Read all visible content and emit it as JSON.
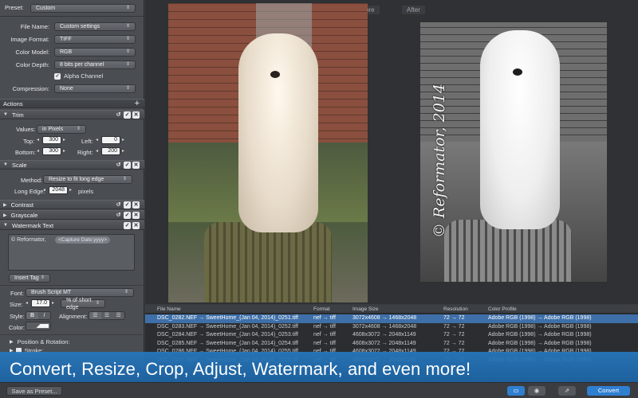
{
  "sidebar": {
    "preset": {
      "label": "Preset:",
      "value": "Custom"
    },
    "file_name": {
      "label": "File Name:",
      "value": "Custom settings"
    },
    "image_format": {
      "label": "Image Format:",
      "value": "TIFF"
    },
    "color_model": {
      "label": "Color Model:",
      "value": "RGB"
    },
    "color_depth": {
      "label": "Color Depth:",
      "value": "8 bits per channel"
    },
    "alpha_channel": {
      "label": "Alpha Channel",
      "checked": true
    },
    "compression": {
      "label": "Compression:",
      "value": "None"
    },
    "actions_title": "Actions",
    "actions_add": "+",
    "trim": {
      "title": "Trim",
      "values_label": "Values:",
      "values_value": "in Pixels",
      "top_label": "Top:",
      "top_value": "300",
      "left_label": "Left:",
      "left_value": "0",
      "bottom_label": "Bottom:",
      "bottom_value": "300",
      "right_label": "Right:",
      "right_value": "200"
    },
    "scale": {
      "title": "Scale",
      "method_label": "Method:",
      "method_value": "Resize to fit long edge",
      "long_edge_label": "Long Edge:",
      "long_edge_value": "2048",
      "long_edge_unit": "pixels"
    },
    "contrast": {
      "title": "Contrast"
    },
    "grayscale": {
      "title": "Grayscale"
    },
    "watermark": {
      "title": "Watermark Text",
      "text_prefix": "© Reformator,",
      "token": "<Capture Date:yyyy>",
      "insert_tag": "Insert Tag",
      "font_label": "Font:",
      "font_value": "Brush Script MT",
      "size_label": "Size:",
      "size_value": "17.0",
      "size_unit": "% of short edge",
      "style_label": "Style:",
      "style_b": "B",
      "style_i": "I",
      "alignment_label": "Alignment:",
      "color_label": "Color:",
      "position_label": "Position & Rotation:",
      "stroke_label": "Stroke:",
      "shadow_label": "Shadow:"
    },
    "footer_button": "Save as Preset..."
  },
  "preview": {
    "before_label": "Before",
    "after_label": "After",
    "watermark_overlay": "© Reformator, 2014"
  },
  "table": {
    "columns": [
      "File Name",
      "Format",
      "Image Size",
      "Resolution",
      "Color Profile"
    ],
    "rows": [
      [
        "DSC_0282.NEF → SweetHome_(Jan 04, 2014)_0251.tiff",
        "nef → tiff",
        "3072x4608 → 1468x2048",
        "72 → 72",
        "Adobe RGB (1998) → Adobe RGB (1998)"
      ],
      [
        "DSC_0283.NEF → SweetHome_(Jan 04, 2014)_0252.tiff",
        "nef → tiff",
        "3072x4608 → 1468x2048",
        "72 → 72",
        "Adobe RGB (1998) → Adobe RGB (1998)"
      ],
      [
        "DSC_0284.NEF → SweetHome_(Jan 04, 2014)_0253.tiff",
        "nef → tiff",
        "4608x3072 → 2048x1149",
        "72 → 72",
        "Adobe RGB (1998) → Adobe RGB (1998)"
      ],
      [
        "DSC_0285.NEF → SweetHome_(Jan 04, 2014)_0254.tiff",
        "nef → tiff",
        "4608x3072 → 2048x1149",
        "72 → 72",
        "Adobe RGB (1998) → Adobe RGB (1998)"
      ],
      [
        "DSC_0286.NEF → SweetHome_(Jan 04, 2014)_0255.tiff",
        "nef → tiff",
        "4608x3072 → 2048x1149",
        "72 → 72",
        "Adobe RGB (1998) → Adobe RGB (1998)"
      ],
      [
        "DSC_0287.NEF → SweetHome_(Jan 04, 2014)_0256.tiff",
        "nef → tiff",
        "4608x3072 → 2048x1149",
        "72 → 72",
        "Adobe RGB (1998) → Adobe RGB (1998)"
      ]
    ],
    "selected_row": 0
  },
  "banner": {
    "text": "Convert, Resize, Crop, Adjust, Watermark, and even more!"
  },
  "toolbar": {
    "convert_label": "Convert"
  },
  "colors": {
    "accent": "#2f7fd1",
    "selected_row": "#3e6fa8",
    "sidebar": "#4a4d52",
    "banner": "#2878be"
  }
}
